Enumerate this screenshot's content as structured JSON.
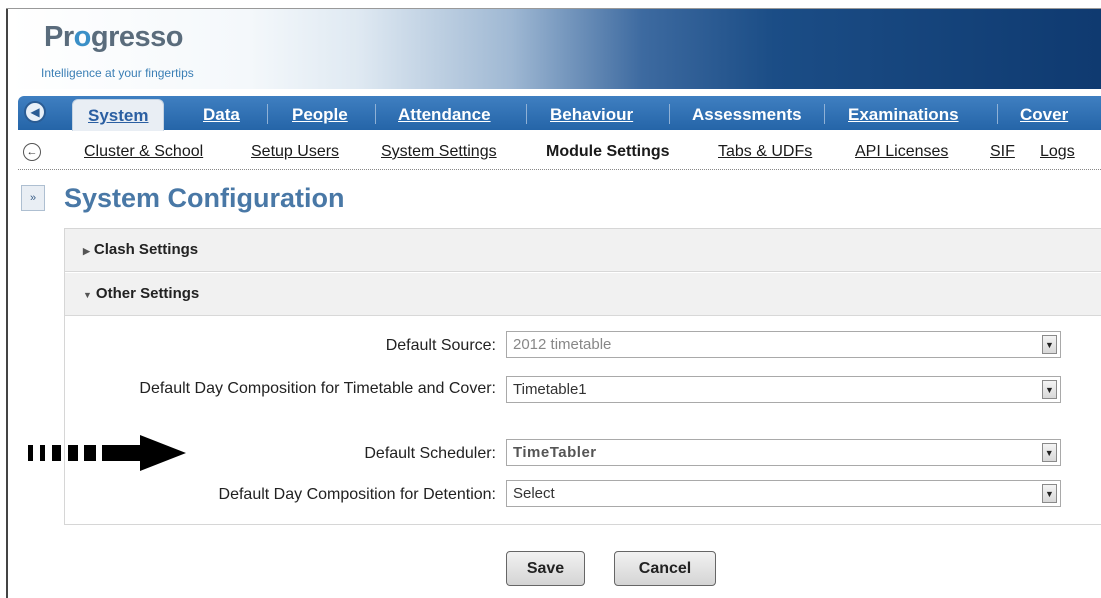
{
  "brand": {
    "logo_text_a": "Pr",
    "logo_text_b": "o",
    "logo_text_c": "gresso",
    "tagline": "Intelligence at your fingertips"
  },
  "main_tabs": [
    {
      "label": "System",
      "active": true
    },
    {
      "label": "Data",
      "active": false
    },
    {
      "label": "People",
      "active": false
    },
    {
      "label": "Attendance",
      "active": false
    },
    {
      "label": "Behaviour",
      "active": false
    },
    {
      "label": "Assessments",
      "active": false
    },
    {
      "label": "Examinations",
      "active": false
    },
    {
      "label": "Cover",
      "active": false
    }
  ],
  "sub_nav": [
    {
      "label": "Cluster & School",
      "active": false
    },
    {
      "label": "Setup Users",
      "active": false
    },
    {
      "label": "System Settings",
      "active": false
    },
    {
      "label": "Module Settings",
      "active": true
    },
    {
      "label": "Tabs & UDFs",
      "active": false
    },
    {
      "label": "API Licenses",
      "active": false
    },
    {
      "label": "SIF",
      "active": false
    },
    {
      "label": "Logs",
      "active": false
    }
  ],
  "page": {
    "title": "System Configuration"
  },
  "sections": {
    "clash": {
      "label": "Clash Settings",
      "expanded": false
    },
    "other": {
      "label": "Other Settings",
      "expanded": true
    }
  },
  "fields": {
    "default_source": {
      "label": "Default Source:",
      "value": "2012 timetable"
    },
    "day_composition_timetable": {
      "label": "Default Day Composition for Timetable and Cover:",
      "value": "Timetable1"
    },
    "default_scheduler": {
      "label": "Default Scheduler:",
      "value": "TimeTabler"
    },
    "day_composition_detention": {
      "label": "Default Day Composition for Detention:",
      "value": "Select"
    }
  },
  "buttons": {
    "save": "Save",
    "cancel": "Cancel"
  },
  "icons": {
    "dropdown": "▼",
    "expand_sidebar": "»",
    "collapsed_arrow": "▶",
    "expanded_arrow": "▼"
  },
  "colors": {
    "accent": "#2565a8",
    "title": "#4978a6"
  }
}
